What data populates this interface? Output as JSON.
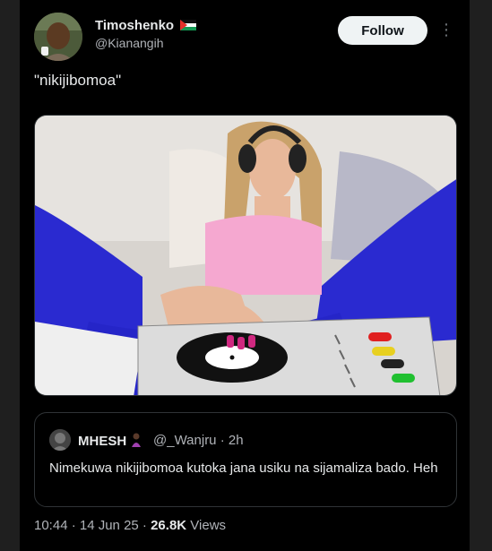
{
  "author": {
    "name": "Timoshenko",
    "handle": "@Kianangih",
    "flag_icon": "palestine-flag-icon"
  },
  "follow_label": "Follow",
  "more_icon": "more-vertical-icon",
  "tweet_text": "\"nikijibomoa\"",
  "media": {
    "description_icon": "photo-dj-turntable"
  },
  "quote": {
    "name": "MHESH",
    "emoji_icon": "woman-emoji-icon",
    "handle_time": "@_Wanjru · 2h",
    "text": "Nimekuwa nikijibomoa kutoka jana usiku na sijamaliza bado. Heh"
  },
  "meta": {
    "time_date": "10:44 · 14 Jun 25 · ",
    "views_count": "26.8K",
    "views_label": " Views"
  },
  "colors": {
    "background": "#000000",
    "text": "#e7e9ea",
    "secondary": "#71767b",
    "border": "#2f3336"
  }
}
